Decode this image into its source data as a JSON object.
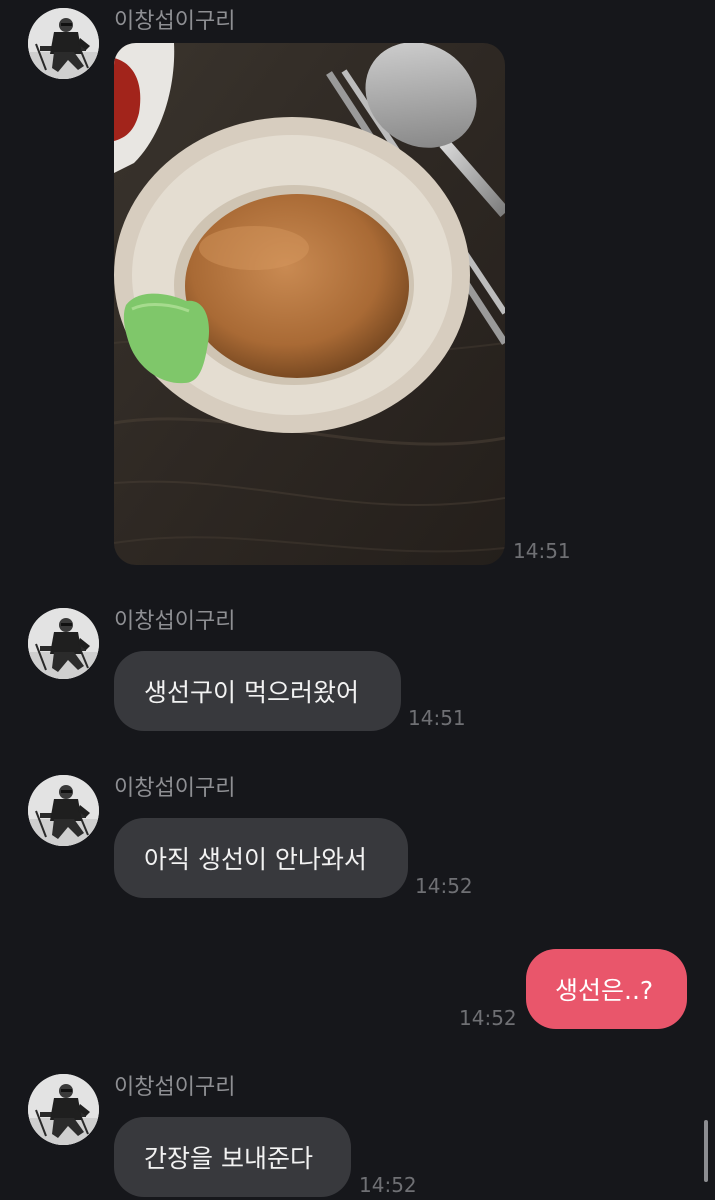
{
  "chat": {
    "messages": [
      {
        "sender": "이창섭이구리",
        "type": "image",
        "image_name": "soy-sauce-bowl-photo",
        "time": "14:51"
      },
      {
        "sender": "이창섭이구리",
        "type": "text",
        "text": "생선구이 먹으러왔어",
        "time": "14:51"
      },
      {
        "sender": "이창섭이구리",
        "type": "text",
        "text": "아직 생선이 안나와서",
        "time": "14:52"
      },
      {
        "sender": "me",
        "type": "text",
        "text": "생선은..?",
        "time": "14:52"
      },
      {
        "sender": "이창섭이구리",
        "type": "text",
        "text": "간장을 보내준다",
        "time": "14:52"
      }
    ]
  },
  "colors": {
    "background": "#16171b",
    "incoming_bubble": "#38393d",
    "outgoing_bubble": "#e9566b",
    "sender_text": "#8e8f93",
    "time_text": "#6f7074"
  },
  "icons": {
    "avatar": "profile-avatar-person-sitting"
  }
}
